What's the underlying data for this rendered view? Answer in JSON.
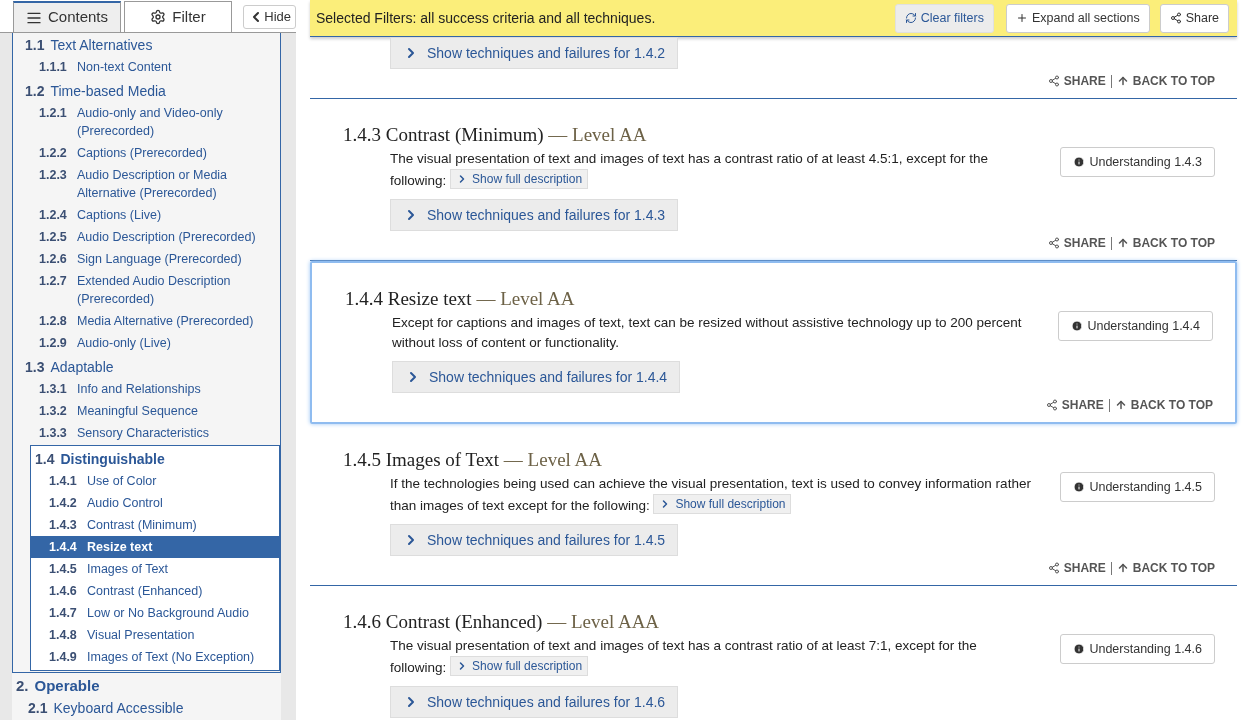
{
  "sidebar": {
    "tabs": [
      {
        "label": "Contents",
        "selected": true
      },
      {
        "label": "Filter",
        "selected": false
      }
    ],
    "hide_button": "Hide",
    "toc": [
      {
        "active": true,
        "children": [
          {
            "number": "1.1",
            "title": "Text Alternatives",
            "active": false,
            "children": [
              {
                "number": "1.1.1",
                "title": "Non-text Content",
                "selected": false
              }
            ]
          },
          {
            "number": "1.2",
            "title": "Time-based Media",
            "active": false,
            "children": [
              {
                "number": "1.2.1",
                "title": "Audio-only and Video-only (Prerecorded)",
                "selected": false
              },
              {
                "number": "1.2.2",
                "title": "Captions (Prerecorded)",
                "selected": false
              },
              {
                "number": "1.2.3",
                "title": "Audio Description or Media Alternative (Prerecorded)",
                "selected": false
              },
              {
                "number": "1.2.4",
                "title": "Captions (Live)",
                "selected": false
              },
              {
                "number": "1.2.5",
                "title": "Audio Description (Prerecorded)",
                "selected": false
              },
              {
                "number": "1.2.6",
                "title": "Sign Language (Prerecorded)",
                "selected": false
              },
              {
                "number": "1.2.7",
                "title": "Extended Audio Description (Prerecorded)",
                "selected": false
              },
              {
                "number": "1.2.8",
                "title": "Media Alternative (Prerecorded)",
                "selected": false
              },
              {
                "number": "1.2.9",
                "title": "Audio-only (Live)",
                "selected": false
              }
            ]
          },
          {
            "number": "1.3",
            "title": "Adaptable",
            "active": false,
            "children": [
              {
                "number": "1.3.1",
                "title": "Info and Relationships",
                "selected": false
              },
              {
                "number": "1.3.2",
                "title": "Meaningful Sequence",
                "selected": false
              },
              {
                "number": "1.3.3",
                "title": "Sensory Characteristics",
                "selected": false
              }
            ]
          },
          {
            "number": "1.4",
            "title": "Distinguishable",
            "active": true,
            "children": [
              {
                "number": "1.4.1",
                "title": "Use of Color",
                "selected": false
              },
              {
                "number": "1.4.2",
                "title": "Audio Control",
                "selected": false
              },
              {
                "number": "1.4.3",
                "title": "Contrast (Minimum)",
                "selected": false
              },
              {
                "number": "1.4.4",
                "title": "Resize text",
                "selected": true
              },
              {
                "number": "1.4.5",
                "title": "Images of Text",
                "selected": false
              },
              {
                "number": "1.4.6",
                "title": "Contrast (Enhanced)",
                "selected": false
              },
              {
                "number": "1.4.7",
                "title": "Low or No Background Audio",
                "selected": false
              },
              {
                "number": "1.4.8",
                "title": "Visual Presentation",
                "selected": false
              },
              {
                "number": "1.4.9",
                "title": "Images of Text (No Exception)",
                "selected": false
              }
            ]
          }
        ]
      },
      {
        "number": "2.",
        "title": "Operable",
        "active": false,
        "children": [
          {
            "number": "2.1",
            "title": "Keyboard Accessible",
            "active": false
          }
        ]
      }
    ]
  },
  "filter_bar": {
    "text": "Selected Filters: all success criteria and all techniques.",
    "buttons": [
      {
        "label": "Clear filters",
        "kind": "pressed"
      },
      {
        "label": "Expand all sections",
        "kind": "plain"
      },
      {
        "label": "Share",
        "kind": "plain"
      }
    ]
  },
  "sections": [
    {
      "techniques": "Show techniques and failures for 1.4.2",
      "share": "SHARE",
      "back_to_top": "BACK TO TOP",
      "focused": false
    },
    {
      "number": "1.4.3",
      "title": "Contrast (Minimum)",
      "level": "— Level AA",
      "description": "The visual presentation of text and images of text has a contrast ratio of at least 4.5:1, except for the following:",
      "full_description": "Show full description",
      "understanding": "Understanding 1.4.3",
      "techniques": "Show techniques and failures for 1.4.3",
      "share": "SHARE",
      "back_to_top": "BACK TO TOP",
      "focused": false
    },
    {
      "number": "1.4.4",
      "title": "Resize text",
      "level": "— Level AA",
      "description": "Except for captions and images of text, text can be resized without assistive technology up to 200 percent without loss of content or functionality.",
      "understanding": "Understanding 1.4.4",
      "techniques": "Show techniques and failures for 1.4.4",
      "share": "SHARE",
      "back_to_top": "BACK TO TOP",
      "focused": true
    },
    {
      "number": "1.4.5",
      "title": "Images of Text",
      "level": "— Level AA",
      "description": "If the technologies being used can achieve the visual presentation, text is used to convey information rather than images of text except for the following:",
      "full_description": "Show full description",
      "understanding": "Understanding 1.4.5",
      "techniques": "Show techniques and failures for 1.4.5",
      "share": "SHARE",
      "back_to_top": "BACK TO TOP",
      "focused": false
    },
    {
      "number": "1.4.6",
      "title": "Contrast (Enhanced)",
      "level": "— Level AAA",
      "description": "The visual presentation of text and images of text has a contrast ratio of at least 7:1, except for the following:",
      "full_description": "Show full description",
      "understanding": "Understanding 1.4.6",
      "techniques": "Show techniques and failures for 1.4.6",
      "focused": false
    }
  ]
}
